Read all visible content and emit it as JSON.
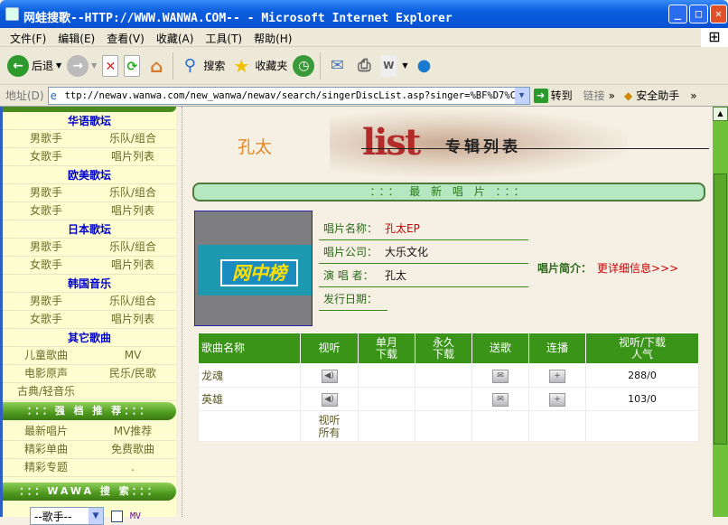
{
  "window": {
    "title": "网蛙搜歌--HTTP://WWW.WANWA.COM-- - Microsoft Internet Explorer",
    "min": "_",
    "max": "□",
    "close": "✕"
  },
  "menu": [
    "文件(F)",
    "编辑(E)",
    "查看(V)",
    "收藏(A)",
    "工具(T)",
    "帮助(H)"
  ],
  "toolbar": {
    "back": "后退",
    "search": "搜索",
    "favorites": "收藏夹"
  },
  "address": {
    "label": "地址(D)",
    "url": "ttp://newav.wanwa.com/new_wanwa/newav/search/singerDiscList.asp?singer=%BF%D7%CC%AB",
    "go": "转到",
    "links": "链接",
    "links_more": "»",
    "assistant": "安全助手",
    "more": "»"
  },
  "sidebar": {
    "sections": [
      {
        "title": "华语歌坛",
        "rows": [
          [
            "男歌手",
            "乐队/组合"
          ],
          [
            "女歌手",
            "唱片列表"
          ]
        ]
      },
      {
        "title": "欧美歌坛",
        "rows": [
          [
            "男歌手",
            "乐队/组合"
          ],
          [
            "女歌手",
            "唱片列表"
          ]
        ]
      },
      {
        "title": "日本歌坛",
        "rows": [
          [
            "男歌手",
            "乐队/组合"
          ],
          [
            "女歌手",
            "唱片列表"
          ]
        ]
      },
      {
        "title": "韩国音乐",
        "rows": [
          [
            "男歌手",
            "乐队/组合"
          ],
          [
            "女歌手",
            "唱片列表"
          ]
        ]
      },
      {
        "title": "其它歌曲",
        "rows": [
          [
            "儿童歌曲",
            "MV"
          ],
          [
            "电影原声",
            "民乐/民歌"
          ],
          [
            "古典/轻音乐",
            ""
          ]
        ]
      }
    ],
    "recommend_bar": "：：：强 档 推 荐：：：",
    "recommend_rows": [
      [
        "最新唱片",
        "MV推荐"
      ],
      [
        "精彩单曲",
        "免费歌曲"
      ],
      [
        "精彩专题",
        "."
      ]
    ],
    "search_bar": "：：：WAWA 搜 索：：：",
    "search_select": "--歌手--",
    "mv_label": "MV"
  },
  "main": {
    "singer": "孔太",
    "banner_logo": "list",
    "banner_title": "专辑列表",
    "latest_bar": "：：： 最 新 唱 片 ：：：",
    "cover_text": "网中榜",
    "info": [
      {
        "k": "唱片名称：",
        "v": "孔太EP"
      },
      {
        "k": "唱片公司：",
        "v": "大乐文化"
      },
      {
        "k": "演 唱 者：",
        "v": "孔太"
      },
      {
        "k": "发行日期：",
        "v": ""
      }
    ],
    "intro_label": "唱片简介：",
    "intro_link": "更详细信息>>>",
    "table": {
      "headers": [
        "歌曲名称",
        "视听",
        "单月\n下载",
        "永久\n下载",
        "送歌",
        "连播",
        "视听/下载\n人气"
      ],
      "rows": [
        {
          "name": "龙魂",
          "count": "288/0"
        },
        {
          "name": "英雄",
          "count": "103/0"
        }
      ],
      "listen_all": "视听\n所有"
    }
  },
  "colors": {
    "accent_green": "#3a9418",
    "sidebar_bg": "#fefdcf",
    "page_bg": "#f6efe4",
    "link_red": "#cc0000"
  }
}
